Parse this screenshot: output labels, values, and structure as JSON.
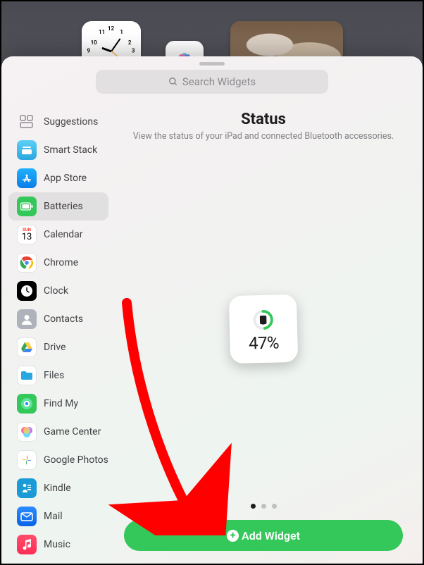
{
  "search": {
    "placeholder": "Search Widgets"
  },
  "sidebar": {
    "items": [
      {
        "label": "Suggestions"
      },
      {
        "label": "Smart Stack"
      },
      {
        "label": "App Store"
      },
      {
        "label": "Batteries"
      },
      {
        "label": "Calendar",
        "day": "13",
        "dow": "SUN"
      },
      {
        "label": "Chrome"
      },
      {
        "label": "Clock"
      },
      {
        "label": "Contacts"
      },
      {
        "label": "Drive"
      },
      {
        "label": "Files"
      },
      {
        "label": "Find My"
      },
      {
        "label": "Game Center"
      },
      {
        "label": "Google Photos"
      },
      {
        "label": "Kindle"
      },
      {
        "label": "Mail"
      },
      {
        "label": "Music"
      }
    ],
    "selected_index": 3
  },
  "main": {
    "title": "Status",
    "subtitle": "View the status of your iPad and connected Bluetooth accessories.",
    "battery_pct": "47%",
    "pages": {
      "count": 3,
      "active": 0
    },
    "add_label": "Add Widget"
  },
  "colors": {
    "accent_green": "#34c759",
    "annotation_red": "#ff0000"
  }
}
